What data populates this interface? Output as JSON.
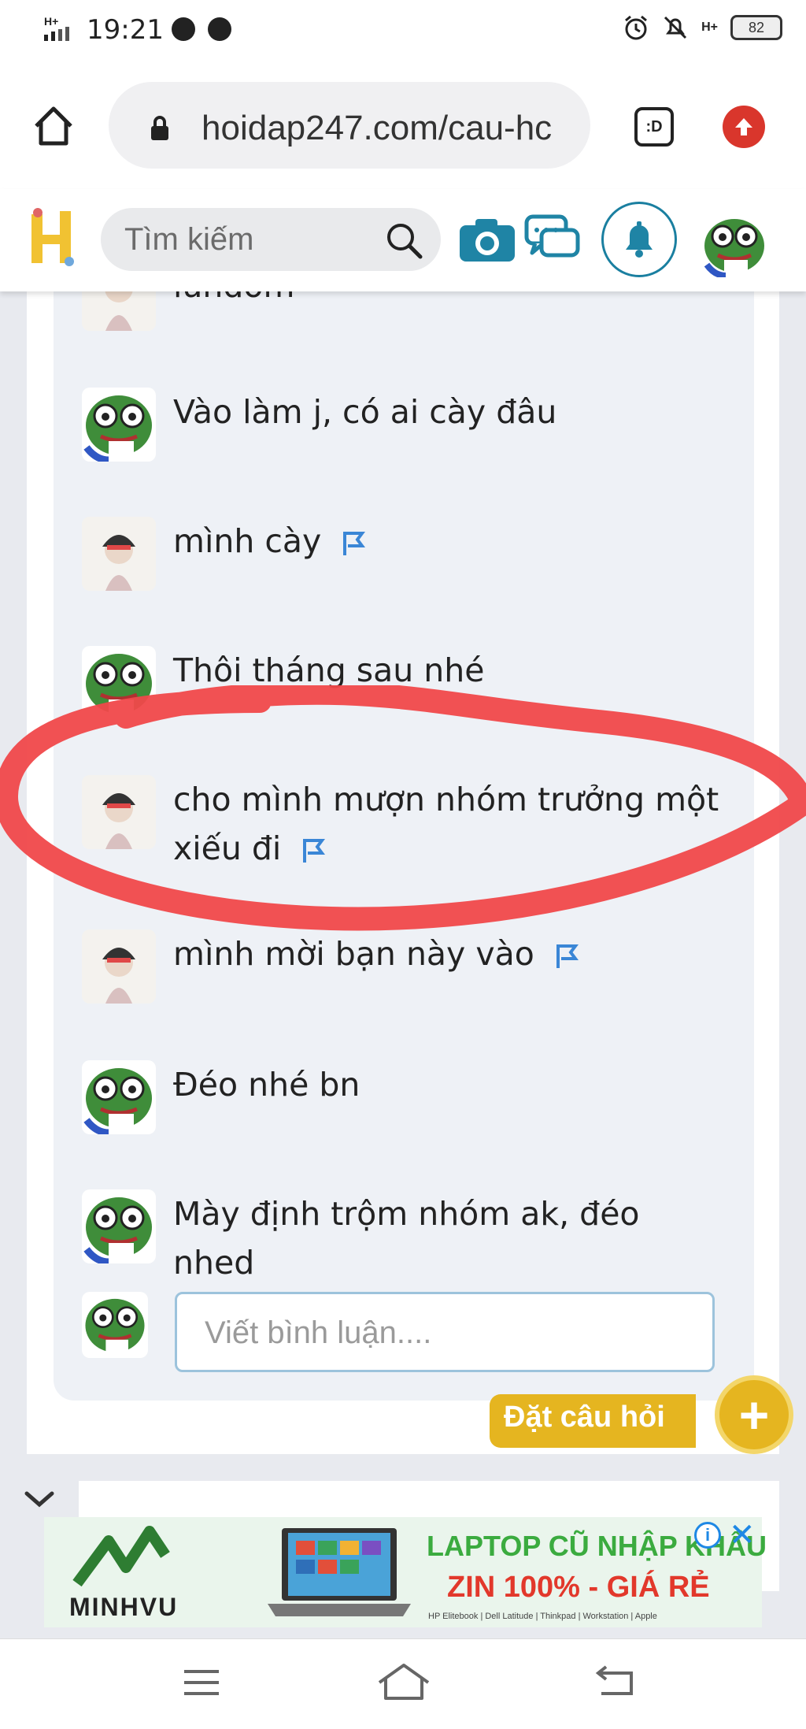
{
  "status_bar": {
    "time": "19:21",
    "network": "H+",
    "network_right": "H+",
    "battery": "82"
  },
  "browser": {
    "url": "hoidap247.com/cau-hc",
    "tabs_label": ":D"
  },
  "site_header": {
    "search_placeholder": "Tìm kiếm"
  },
  "comments": [
    {
      "text": "lundom",
      "avatar": "girl-avatar",
      "flag": true
    },
    {
      "text": "Vào làm j, có ai cày đâu",
      "avatar": "frog-avatar",
      "flag": false
    },
    {
      "text": "mình cày",
      "avatar": "girl-avatar",
      "flag": true
    },
    {
      "text": "Thôi tháng sau nhé",
      "avatar": "frog-avatar",
      "flag": false
    },
    {
      "text": "cho mình mượn nhóm trưởng một xiếu đi",
      "avatar": "girl-avatar",
      "flag": true
    },
    {
      "text": "mình mời bạn này vào",
      "avatar": "girl-avatar",
      "flag": true
    },
    {
      "text": "Đéo nhé bn",
      "avatar": "frog-avatar",
      "flag": false
    },
    {
      "text": "Mày định trộm nhóm ak, đéo nhed",
      "avatar": "frog-avatar",
      "flag": false
    }
  ],
  "comment_input": {
    "placeholder": "Viết bình luận...."
  },
  "ask_button": {
    "label": "Đặt câu hỏi",
    "plus": "+"
  },
  "ad": {
    "brand": "MINHVU",
    "title_line1": "LAPTOP CŨ NHẬP KHẨU",
    "title_line2": "ZIN 100% - GIÁ RẺ",
    "subtitle": "HP Elitebook | Dell Latitude | Thinkpad | Workstation | Apple",
    "info": "i",
    "close": "✕"
  },
  "colors": {
    "accent_blue": "#1a7fa0",
    "flag_blue": "#3a86d6",
    "ask_yellow": "#e5b520",
    "scribble_red": "#f0484a"
  }
}
